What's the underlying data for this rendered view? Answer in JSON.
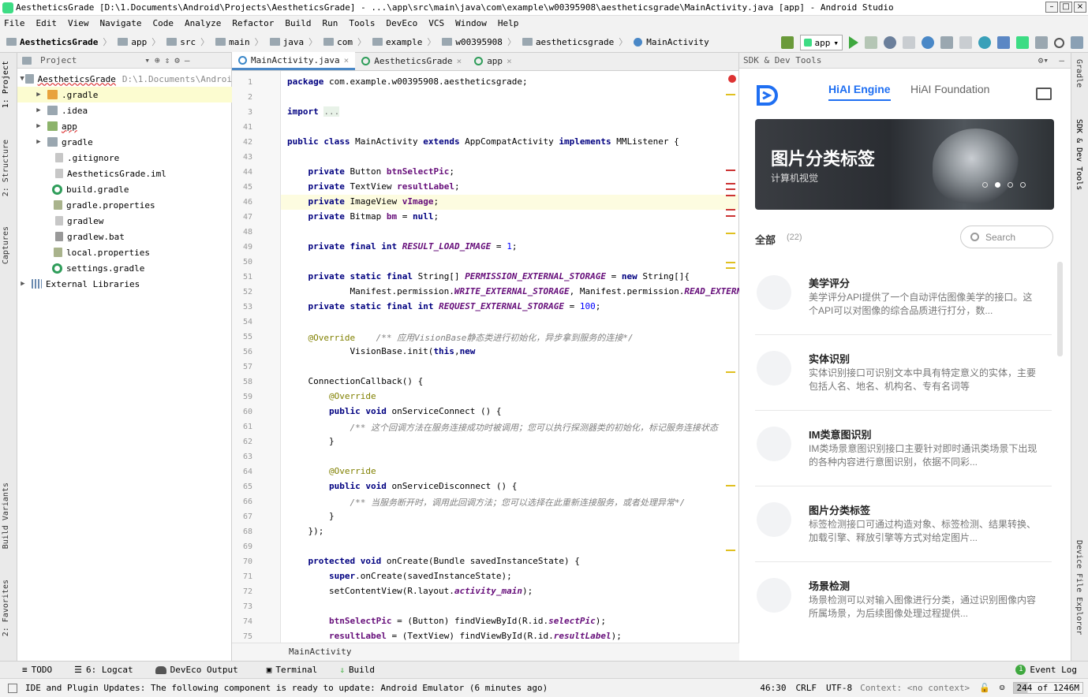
{
  "window": {
    "title": "AestheticsGrade [D:\\1.Documents\\Android\\Projects\\AestheticsGrade] - ...\\app\\src\\main\\java\\com\\example\\w00395908\\aestheticsgrade\\MainActivity.java [app] - Android Studio"
  },
  "menu": [
    "File",
    "Edit",
    "View",
    "Navigate",
    "Code",
    "Analyze",
    "Refactor",
    "Build",
    "Run",
    "Tools",
    "DevEco",
    "VCS",
    "Window",
    "Help"
  ],
  "breadcrumbs": [
    "AestheticsGrade",
    "app",
    "src",
    "main",
    "java",
    "com",
    "example",
    "w00395908",
    "aestheticsgrade",
    "MainActivity"
  ],
  "run_config": "app",
  "left_tabs": [
    "1: Project",
    "2: Structure",
    "Captures",
    "Build Variants",
    "2: Favorites"
  ],
  "project": {
    "header": "Project",
    "root": "AestheticsGrade",
    "root_path": "D:\\1.Documents\\Androi",
    "items": [
      ".gradle",
      ".idea",
      "app",
      "gradle",
      ".gitignore",
      "AestheticsGrade.iml",
      "build.gradle",
      "gradle.properties",
      "gradlew",
      "gradlew.bat",
      "local.properties",
      "settings.gradle",
      "External Libraries"
    ]
  },
  "editor": {
    "tabs": [
      "MainActivity.java",
      "AestheticsGrade",
      "app"
    ],
    "footer": "MainActivity",
    "line_numbers": [
      "1",
      "2",
      "3",
      "41",
      "42",
      "43",
      "44",
      "45",
      "46",
      "47",
      "48",
      "49",
      "50",
      "51",
      "52",
      "53",
      "54",
      "55",
      "56",
      "57",
      "58",
      "59",
      "60",
      "61",
      "62",
      "63",
      "64",
      "65",
      "66",
      "67",
      "68",
      "69",
      "70",
      "71",
      "72",
      "73",
      "74",
      "75"
    ]
  },
  "sdk": {
    "header": "SDK & Dev Tools",
    "tab_engine": "HiAI Engine",
    "tab_foundation": "HiAI Foundation",
    "banner_title": "图片分类标签",
    "banner_sub": "计算机视觉",
    "all_label": "全部",
    "all_count": "(22)",
    "search_placeholder": "Search",
    "items": [
      {
        "title": "美学评分",
        "desc": "美学评分API提供了一个自动评估图像美学的接口。这个API可以对图像的综合品质进行打分，数..."
      },
      {
        "title": "实体识别",
        "desc": "实体识别接口可识别文本中具有特定意义的实体，主要包括人名、地名、机构名、专有名词等"
      },
      {
        "title": "IM类意图识别",
        "desc": "IM类场景意图识别接口主要针对即时通讯类场景下出现的各种内容进行意图识别，依据不同彩..."
      },
      {
        "title": "图片分类标签",
        "desc": "标签检测接口可通过构造对象、标签检测、结果转换、加载引擎、释放引擎等方式对给定图片..."
      },
      {
        "title": "场景检测",
        "desc": "场景检测可以对输入图像进行分类，通过识别图像内容所属场景，为后续图像处理过程提供..."
      }
    ]
  },
  "right_tabs": [
    "Gradle",
    "SDK & Dev Tools",
    "Device File Explorer"
  ],
  "bottom": {
    "todo": "TODO",
    "logcat": "6: Logcat",
    "deveco": "DevEco Output",
    "terminal": "Terminal",
    "build": "Build",
    "event_log": "Event Log",
    "event_count": "1"
  },
  "status": {
    "message": "IDE and Plugin Updates: The following component is ready to update: Android Emulator (6 minutes ago)",
    "position": "46:30",
    "line_sep": "CRLF",
    "encoding": "UTF-8",
    "context": "Context: <no context>",
    "memory": "244 of 1246M"
  }
}
